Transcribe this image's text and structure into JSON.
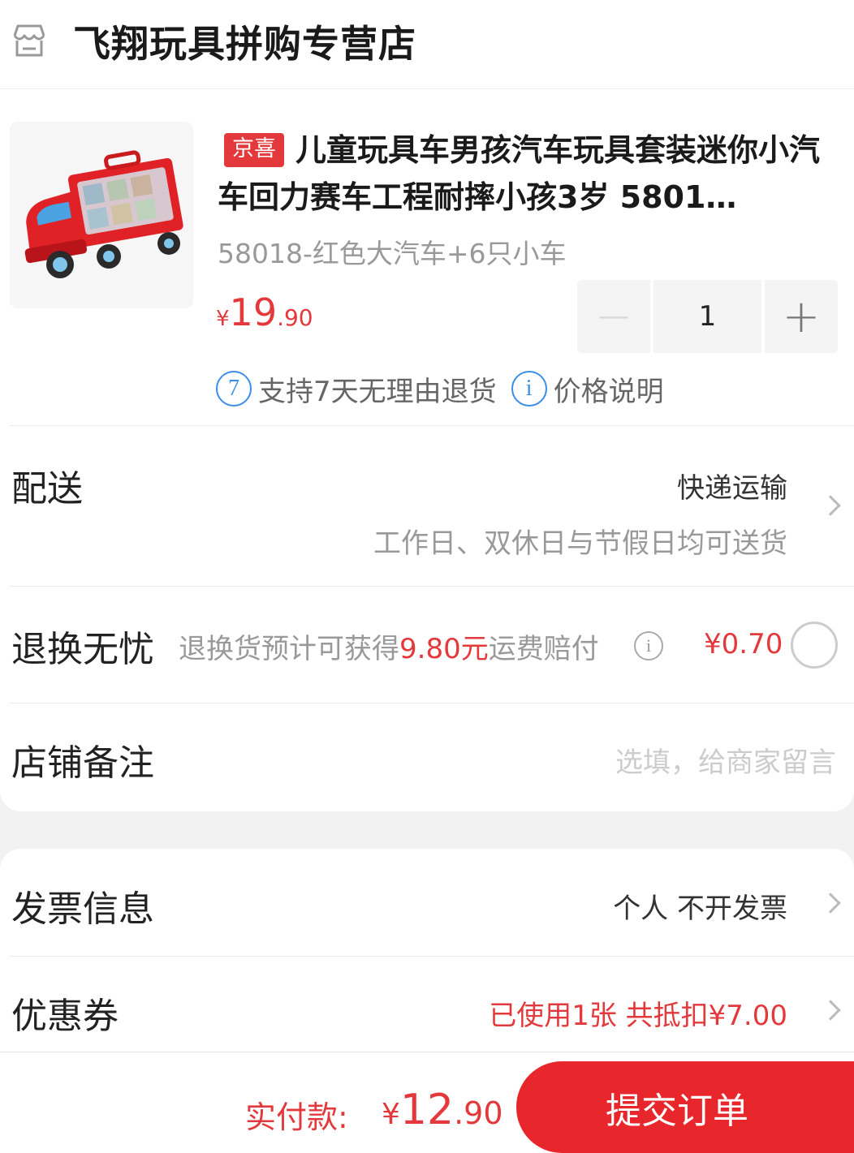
{
  "store": {
    "name": "飞翔玩具拼购专营店",
    "icon": "store-icon"
  },
  "product": {
    "tag": "京喜",
    "title": "儿童玩具车男孩汽车玩具套装迷你小汽车回力赛车工程耐摔小孩3岁 5801…",
    "spec": "58018-红色大汽车+6只小车",
    "price": {
      "symbol": "¥",
      "integer": "19",
      "decimal": ".90"
    },
    "quantity": "1",
    "minus": "−",
    "plus": "+",
    "services": [
      {
        "icon_text": "7",
        "text": "支持7天无理由退货"
      },
      {
        "icon_text": "i",
        "text": "价格说明"
      }
    ]
  },
  "delivery": {
    "label": "配送",
    "method": "快递运输",
    "time": "工作日、双休日与节假日均可送货"
  },
  "return_worry_free": {
    "label": "退换无忧",
    "desc_prefix": "退换货预计可获得",
    "desc_amount": "9.80元",
    "desc_suffix": "运费赔付",
    "info_icon_text": "i",
    "price": "¥0.70",
    "selected": false
  },
  "store_note": {
    "label": "店铺备注",
    "placeholder": "选填，给商家留言"
  },
  "invoice": {
    "label": "发票信息",
    "value": "个人 不开发票"
  },
  "coupon": {
    "label": "优惠券",
    "value": "已使用1张 共抵扣¥7.00"
  },
  "bottom": {
    "pay_label": "实付款:",
    "pay_symbol": "¥",
    "pay_integer": "12",
    "pay_decimal": ".90",
    "submit_label": "提交订单"
  },
  "colors": {
    "accent": "#e4393c",
    "submit": "#e8272c",
    "info_blue": "#3b8ee8"
  }
}
